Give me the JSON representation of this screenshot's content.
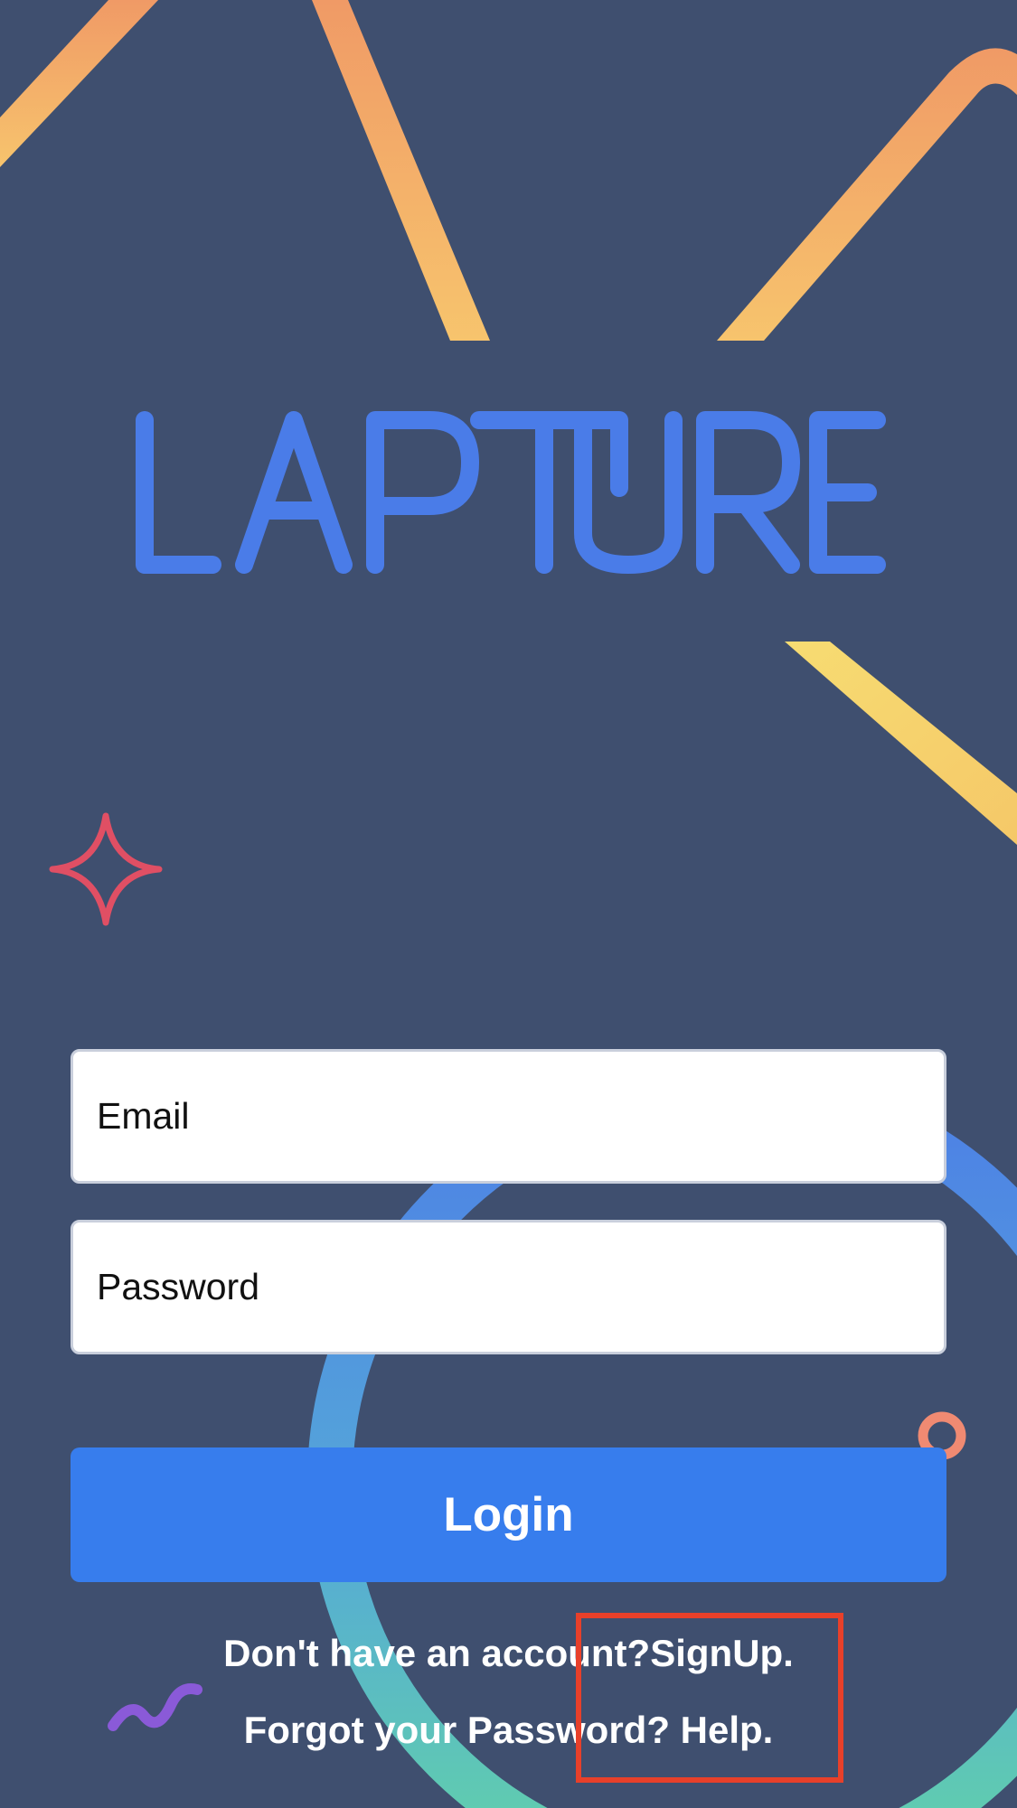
{
  "app": {
    "logo_text": "LAPTURE"
  },
  "form": {
    "email_placeholder": "Email",
    "password_placeholder": "Password",
    "login_label": "Login"
  },
  "footer": {
    "signup_prompt": "Don't have an account?",
    "signup_link": "SignUp.",
    "forgot_prompt": "Forgot your Password?",
    "help_link": "Help."
  },
  "colors": {
    "background": "#3f4f6f",
    "logo": "#4a7ce8",
    "login_button": "#377ded",
    "highlight": "#e8402a",
    "decor_orange": "#f0a56a",
    "decor_yellow": "#f8dc74",
    "decor_pink": "#e04f64",
    "decor_purple": "#8a5ad8"
  }
}
